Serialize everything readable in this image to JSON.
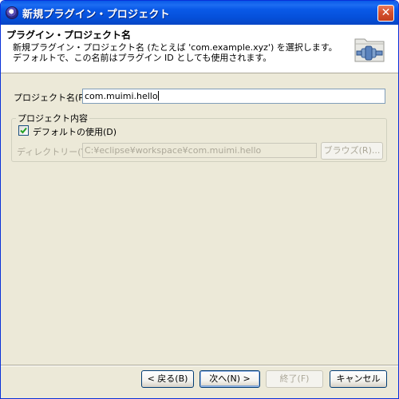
{
  "window": {
    "title": "新規プラグイン・プロジェクト"
  },
  "banner": {
    "title": "プラグイン・プロジェクト名",
    "message": "新規プラグイン・プロジェクト名 (たとえば 'com.example.xyz') を選択します。デフォルトで、この名前はプラグイン ID としても使用されます。"
  },
  "form": {
    "project_name_label": "プロジェクト名(P):",
    "project_name_value": "com.muimi.hello",
    "contents_group_label": "プロジェクト内容",
    "use_default_label": "デフォルトの使用(D)",
    "use_default_checked": true,
    "directory_label": "ディレクトリー(Y):",
    "directory_value": "C:¥eclipse¥workspace¥com.muimi.hello",
    "browse_label": "ブラウズ(R)..."
  },
  "footer": {
    "back_label": "< 戻る(B)",
    "next_label": "次へ(N) >",
    "finish_label": "終了(F)",
    "cancel_label": "キャンセル"
  },
  "colors": {
    "title_bar": "#0a5ae8",
    "dialog_bg": "#ece9d8",
    "banner_bg": "#ffffff"
  }
}
